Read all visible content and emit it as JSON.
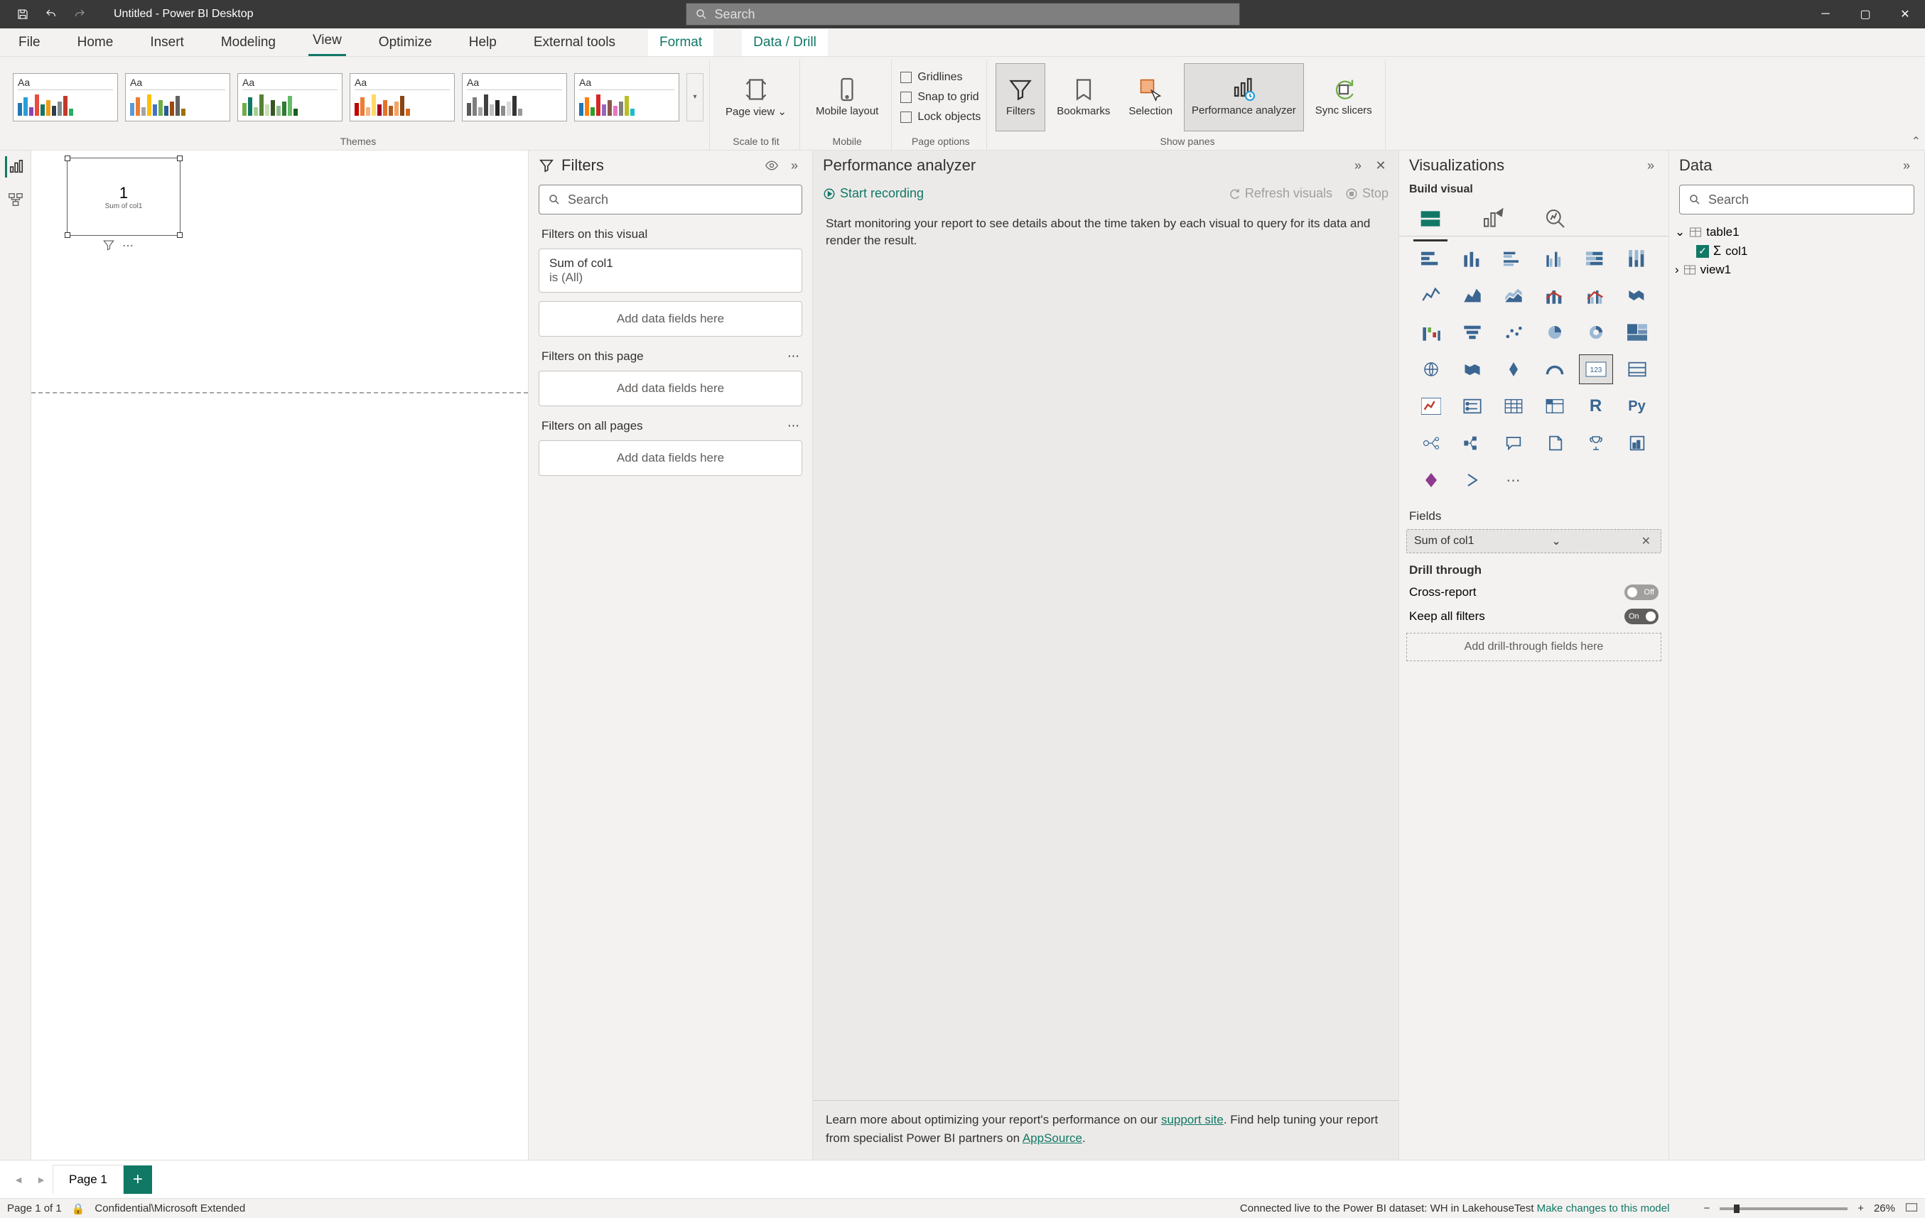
{
  "app": {
    "title": "Untitled - Power BI Desktop",
    "search_placeholder": "Search"
  },
  "ribbon_tabs": [
    "File",
    "Home",
    "Insert",
    "Modeling",
    "View",
    "Optimize",
    "Help",
    "External tools",
    "Format",
    "Data / Drill"
  ],
  "ribbon_active": "View",
  "ribbon": {
    "themes_label": "Themes",
    "scale_label": "Scale to fit",
    "mobile_label": "Mobile",
    "page_opts_label": "Page options",
    "show_panes_label": "Show panes",
    "page_view": "Page view",
    "mobile_layout": "Mobile layout",
    "gridlines": "Gridlines",
    "snap": "Snap to grid",
    "lock": "Lock objects",
    "filters_btn": "Filters",
    "bookmarks_btn": "Bookmarks",
    "selection_btn": "Selection",
    "perf_btn": "Performance analyzer",
    "sync_btn": "Sync slicers"
  },
  "canvas": {
    "visual_value": "1",
    "visual_label": "Sum of col1"
  },
  "filters": {
    "title": "Filters",
    "search_placeholder": "Search",
    "on_visual": "Filters on this visual",
    "card_title": "Sum of col1",
    "card_sub": "is (All)",
    "drop": "Add data fields here",
    "on_page": "Filters on this page",
    "on_all": "Filters on all pages"
  },
  "perf": {
    "title": "Performance analyzer",
    "start": "Start recording",
    "refresh": "Refresh visuals",
    "stop": "Stop",
    "hint": "Start monitoring your report to see details about the time taken by each visual to query for its data and render the result.",
    "learn1": "Learn more about optimizing your report's performance on our ",
    "support": "support site",
    "learn2": ". Find help tuning your report from specialist Power BI partners on ",
    "appsource": "AppSource"
  },
  "viz": {
    "title": "Visualizations",
    "sub": "Build visual",
    "fields_hdr": "Fields",
    "pill": "Sum of col1",
    "drill_hdr": "Drill through",
    "cross": "Cross-report",
    "keep": "Keep all filters",
    "off": "Off",
    "on": "On",
    "drill_drop": "Add drill-through fields here"
  },
  "data": {
    "title": "Data",
    "search_placeholder": "Search",
    "table": "table1",
    "col": "col1",
    "view": "view1"
  },
  "pagebar": {
    "page": "Page 1"
  },
  "status": {
    "page": "Page 1 of 1",
    "sens": "Confidential\\Microsoft Extended",
    "conn": "Connected live to the Power BI dataset: WH in LakehouseTest ",
    "changes": "Make changes to this model",
    "zoom": "26%"
  }
}
